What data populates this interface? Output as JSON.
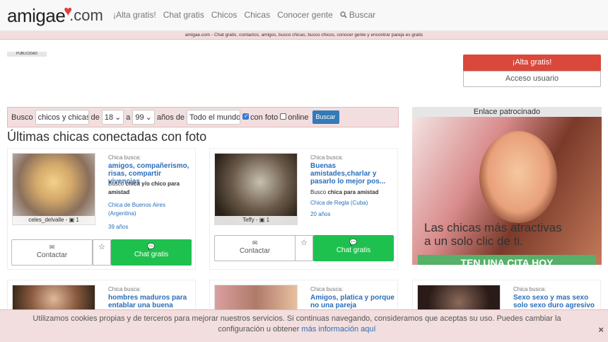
{
  "brand": {
    "logo_main": "amigae",
    "logo_domain": ".com"
  },
  "nav": {
    "items": [
      "¡Alta gratis!",
      "Chat gratis",
      "Chicos",
      "Chicas",
      "Conocer gente"
    ],
    "search": "Buscar"
  },
  "tagline": "amigae.com - Chat gratis, contactos, amigos, busco chicas, busco chicos, conocer gente y encontrar pareja es gratis",
  "publicidad": "PUBLICIDAD",
  "auth": {
    "alta": "¡Alta gratis!",
    "acceso": "Acceso usuario"
  },
  "searchbar": {
    "busco": "Busco",
    "sexo": "chicos y chicas",
    "de": "de",
    "edad_min": "18",
    "a": "a",
    "edad_max": "99",
    "anos_de": "años de",
    "lugar": "Todo el mundo",
    "con_foto": "con foto",
    "online": "online",
    "buscar": "Buscar"
  },
  "section_title": "Últimas chicas conectadas con foto",
  "sponsor": {
    "label": "Enlace patrocinado",
    "line1": "Las chicas más atractivas",
    "line2": "a un solo clic de ti.",
    "cta": "TEN UNA CITA HOY"
  },
  "card_labels": {
    "busca": "Chica busca:",
    "contactar": "Contactar",
    "chat": "Chat gratis",
    "busco": "Busco"
  },
  "cards": [
    {
      "caption": "celes_delvalle - ",
      "photos": "1",
      "title": "amigos, compañerismo, risas, compartir vivencias",
      "looking_for": "chica y/o chico para amistad",
      "city": "Chica de Buenos Aires",
      "country": "Argentina",
      "age": "39 años"
    },
    {
      "caption": "Teffy - ",
      "photos": "1",
      "title": "Buenas amistades,charlar y pasarlo lo mejor pos...",
      "looking_for": "chica para amistad",
      "city": "Chica de Regla",
      "country": "Cuba",
      "age": "20 años"
    }
  ],
  "cards_row2": [
    {
      "title": "hombres maduros para entablar una buena"
    },
    {
      "title": "Amigos, platica y porque no una pareja"
    },
    {
      "title": "Sexo sexo y mas sexo solo sexo duro agresivo"
    }
  ],
  "cookie": {
    "text": "Utilizamos cookies propias y de terceros para mejorar nuestros servicios. Si continuas navegando, consideramos que aceptas su uso. Puedes cambiar la configuración u obtener ",
    "more": "más información aquí",
    "close": "×"
  }
}
